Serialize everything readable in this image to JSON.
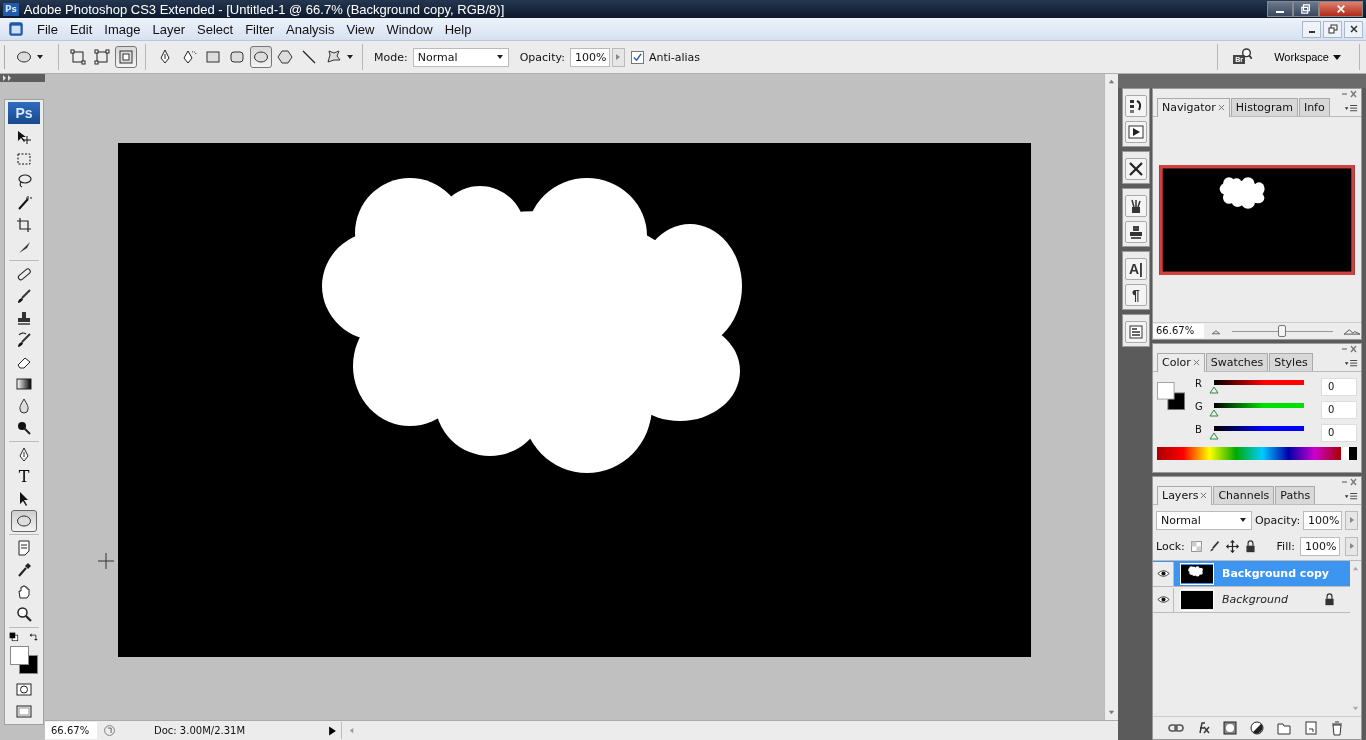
{
  "window": {
    "title": "Adobe Photoshop CS3 Extended - [Untitled-1 @ 66.7% (Background copy, RGB/8)]",
    "logo": "Ps"
  },
  "menu": [
    "File",
    "Edit",
    "Image",
    "Layer",
    "Select",
    "Filter",
    "Analysis",
    "View",
    "Window",
    "Help"
  ],
  "options_bar": {
    "shape_modes": [
      {
        "kind": "shape-layer",
        "selected": false
      },
      {
        "kind": "paths",
        "selected": false
      },
      {
        "kind": "fill-pixels",
        "selected": true
      }
    ],
    "shape_tools": [
      {
        "kind": "pen",
        "selected": false
      },
      {
        "kind": "freeform-pen",
        "selected": false
      },
      {
        "kind": "rectangle",
        "selected": false
      },
      {
        "kind": "rounded-rectangle",
        "selected": false
      },
      {
        "kind": "ellipse",
        "selected": true
      },
      {
        "kind": "polygon",
        "selected": false
      },
      {
        "kind": "line",
        "selected": false
      },
      {
        "kind": "custom-shape",
        "selected": false
      }
    ],
    "mode_label": "Mode:",
    "mode_value": "Normal",
    "opacity_label": "Opacity:",
    "opacity_value": "100%",
    "anti_alias": {
      "label": "Anti-alias",
      "checked": true
    },
    "bridge_label": "Br",
    "workspace": "Workspace"
  },
  "toolbox": {
    "logo": "Ps",
    "groups": [
      [
        {
          "kind": "move-arrow",
          "selected": false
        },
        {
          "kind": "dashed-rectangle",
          "selected": false
        },
        {
          "kind": "lasso",
          "selected": false
        },
        {
          "kind": "wand",
          "selected": false
        },
        {
          "kind": "crop",
          "selected": false
        },
        {
          "kind": "knife",
          "selected": false
        }
      ],
      [
        {
          "kind": "bandage",
          "selected": false
        },
        {
          "kind": "brush",
          "selected": false
        },
        {
          "kind": "stamp",
          "selected": false
        },
        {
          "kind": "history-brush",
          "selected": false
        },
        {
          "kind": "eraser",
          "selected": false
        },
        {
          "kind": "gradient",
          "selected": false
        },
        {
          "kind": "drop",
          "selected": false
        },
        {
          "kind": "burn",
          "selected": false
        }
      ],
      [
        {
          "kind": "pen",
          "selected": false
        },
        {
          "kind": "type",
          "glyph": "T",
          "selected": false
        },
        {
          "kind": "arrow",
          "selected": false
        },
        {
          "kind": "ellipse",
          "selected": true
        }
      ],
      [
        {
          "kind": "note",
          "selected": false
        },
        {
          "kind": "eyedropper",
          "selected": false
        },
        {
          "kind": "hand",
          "selected": false
        },
        {
          "kind": "magnifier",
          "selected": false
        }
      ]
    ]
  },
  "status_bar": {
    "zoom": "66.67%",
    "doc": "Doc: 3.00M/2.31M"
  },
  "dock": [
    [
      {
        "kind": "history"
      },
      {
        "kind": "play"
      }
    ],
    [
      {
        "kind": "tools"
      }
    ],
    [
      {
        "kind": "brushes"
      },
      {
        "kind": "clone-source"
      }
    ],
    [
      {
        "kind": "character",
        "glyph": "A|"
      },
      {
        "kind": "paragraph",
        "glyph": "¶"
      }
    ],
    [
      {
        "kind": "layer-comps"
      }
    ]
  ],
  "navigator": {
    "tabs": [
      {
        "label": "Navigator",
        "selected": true
      },
      {
        "label": "Histogram",
        "selected": false
      },
      {
        "label": "Info",
        "selected": false
      }
    ],
    "zoom": "66.67%",
    "level": 0.49
  },
  "color_panel": {
    "tabs": [
      {
        "label": "Color",
        "selected": true
      },
      {
        "label": "Swatches",
        "selected": false
      },
      {
        "label": "Styles",
        "selected": false
      }
    ],
    "channels": [
      {
        "name": "R",
        "value": "0",
        "level": 0,
        "color": "#ff0000"
      },
      {
        "name": "G",
        "value": "0",
        "level": 0,
        "color": "#00e000"
      },
      {
        "name": "B",
        "value": "0",
        "level": 0,
        "color": "#0000ff"
      }
    ]
  },
  "layers_panel": {
    "tabs": [
      {
        "label": "Layers",
        "selected": true
      },
      {
        "label": "Channels",
        "selected": false
      },
      {
        "label": "Paths",
        "selected": false
      }
    ],
    "blend_mode": "Normal",
    "opacity_label": "Opacity:",
    "opacity": "100%",
    "lock_label": "Lock:",
    "fill_label": "Fill:",
    "fill": "100%",
    "layers": [
      {
        "name": "Background copy",
        "kind": "normal",
        "selected": true,
        "visible": true,
        "locked": false
      },
      {
        "name": "Background",
        "kind": "background",
        "selected": false,
        "visible": true,
        "locked": true
      }
    ]
  }
}
